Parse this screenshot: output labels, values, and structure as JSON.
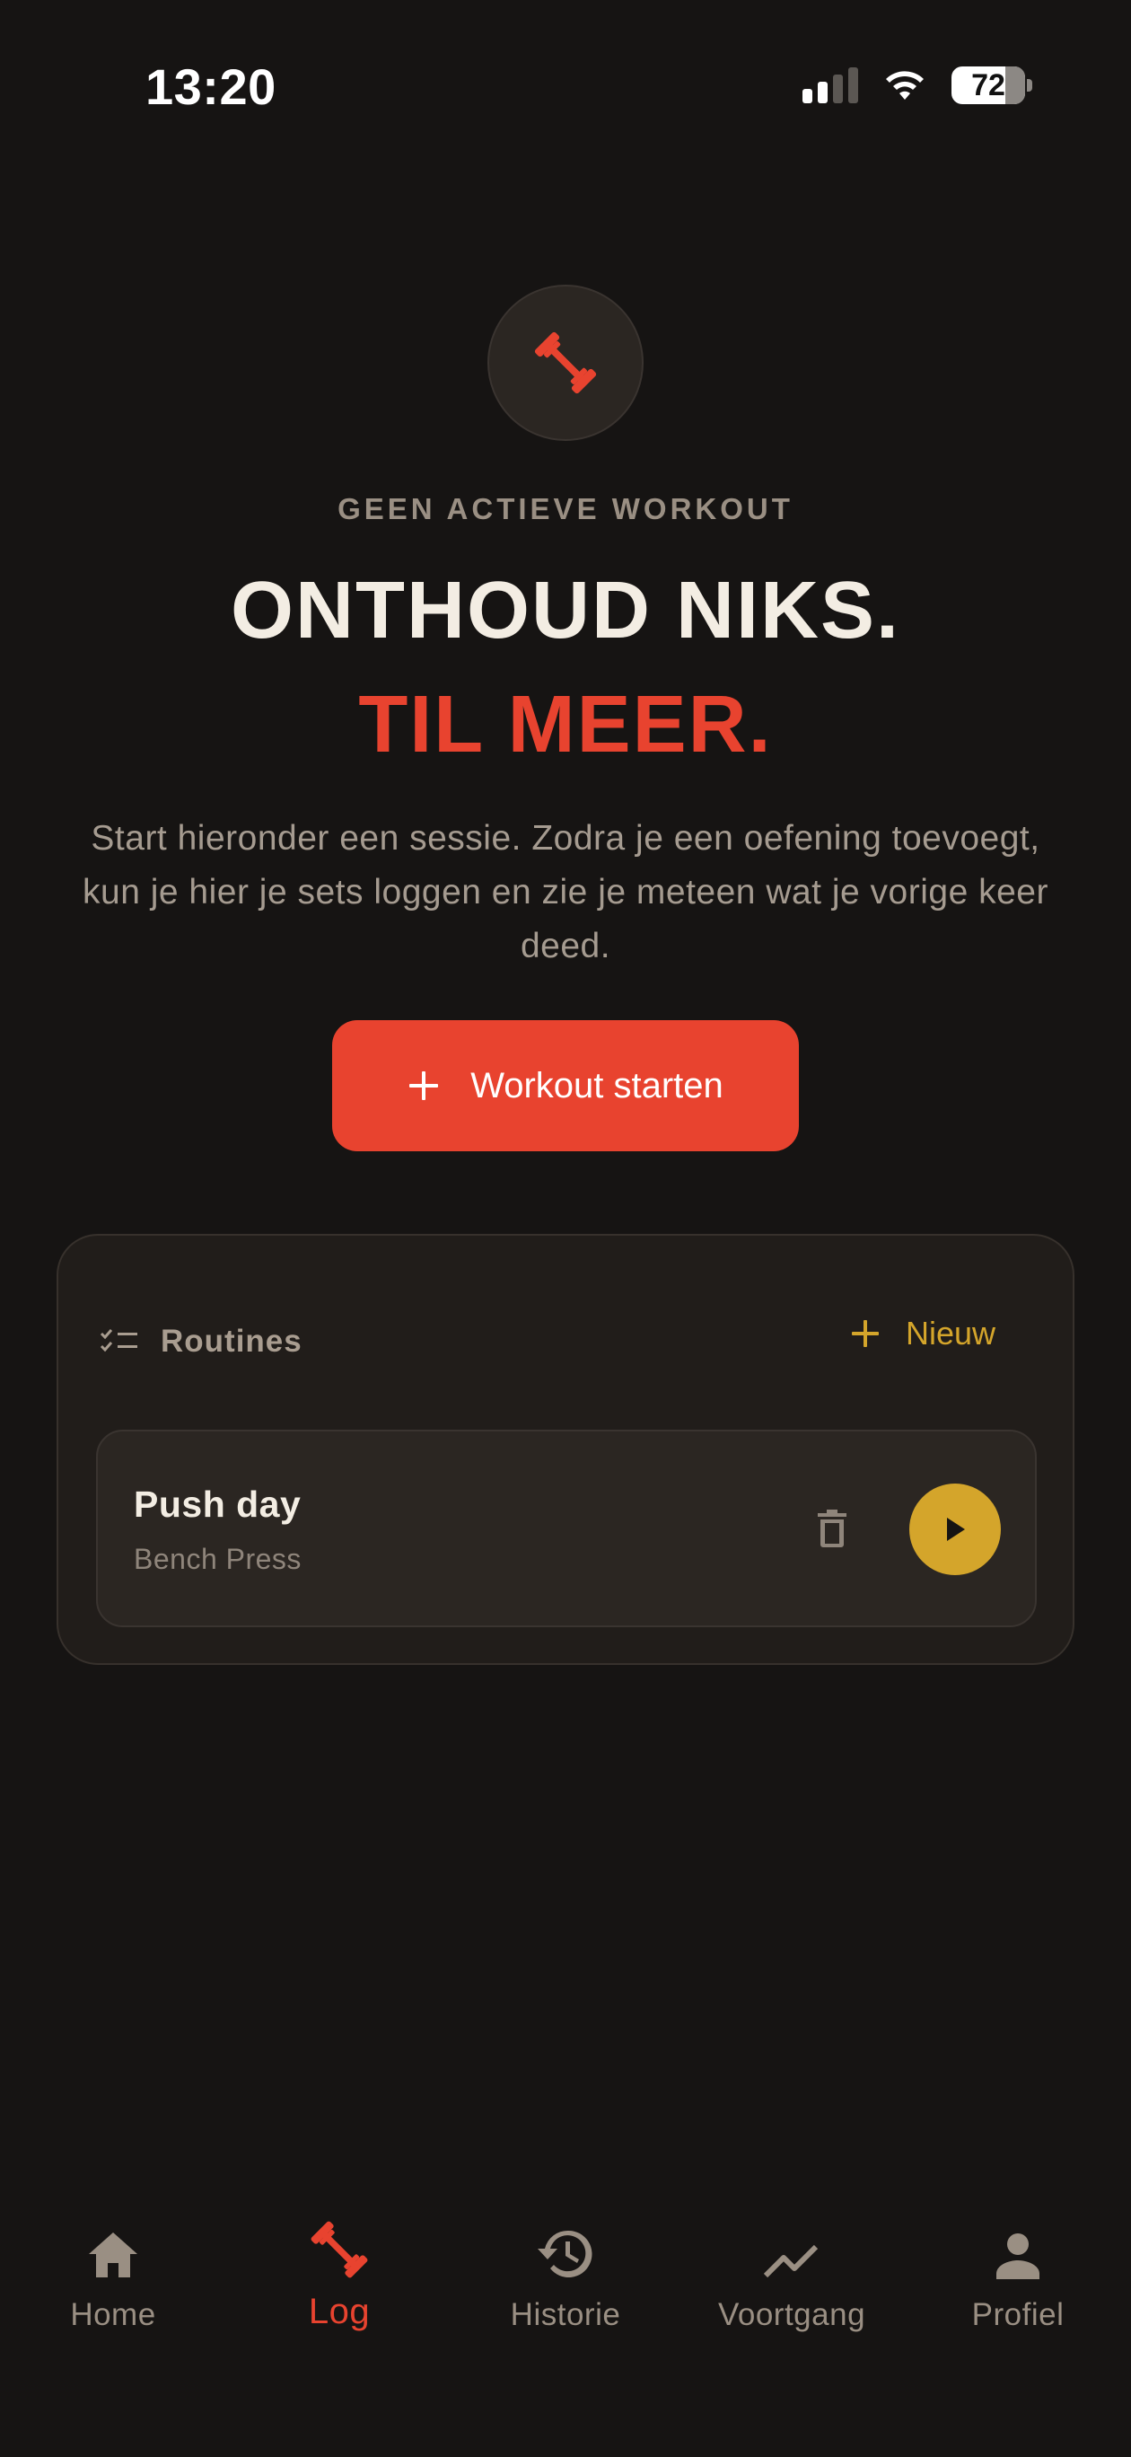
{
  "status_bar": {
    "time": "13:20",
    "battery_level": "72",
    "icons": [
      "signal-icon",
      "wifi-icon",
      "battery-icon"
    ]
  },
  "hero": {
    "icon": "dumbbell-icon",
    "eyebrow": "GEEN ACTIEVE WORKOUT",
    "headline": "ONTHOUD NIKS.",
    "headline_accent": "TIL MEER.",
    "description": "Start hieronder een sessie. Zodra je een oefening toevoegt, kun je hier je sets loggen en zie je meteen wat je vorige keer deed.",
    "start_button": {
      "icon": "plus-icon",
      "label": "Workout starten"
    }
  },
  "routines": {
    "title": "Routines",
    "title_icon": "checklist-icon",
    "new_button": {
      "icon": "plus-icon",
      "label": "Nieuw"
    },
    "items": [
      {
        "name": "Push day",
        "exercises": "Bench Press",
        "delete_icon": "trash-icon",
        "play_icon": "play-icon"
      }
    ]
  },
  "bottom_nav": {
    "items": [
      {
        "label": "Home",
        "icon": "home-icon",
        "active": false
      },
      {
        "label": "Log",
        "icon": "dumbbell-icon",
        "active": true
      },
      {
        "label": "Historie",
        "icon": "history-icon",
        "active": false
      },
      {
        "label": "Voortgang",
        "icon": "trend-icon",
        "active": false
      },
      {
        "label": "Profiel",
        "icon": "person-icon",
        "active": false
      }
    ]
  },
  "colors": {
    "background": "#161413",
    "accent_red": "#e8432f",
    "accent_gold": "#d4a52b",
    "muted_text": "#9a8f83",
    "card": "#211d1a"
  }
}
